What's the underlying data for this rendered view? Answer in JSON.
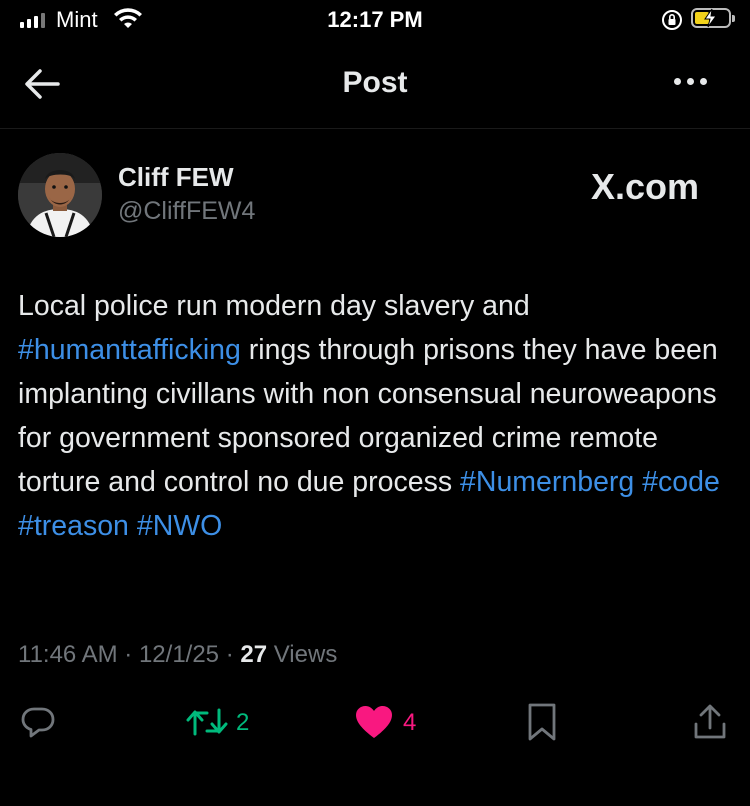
{
  "status_bar": {
    "carrier": "Mint",
    "time": "12:17 PM"
  },
  "header": {
    "title": "Post",
    "back_icon": "arrow-left-icon",
    "more_icon": "more-horizontal-icon"
  },
  "post": {
    "author": {
      "name": "Cliff FEW",
      "handle": "@CliffFEW4"
    },
    "brand": "X.com",
    "text_segments": [
      {
        "text": "Local police run modern day slavery and ",
        "hashtag": false
      },
      {
        "text": "#humanttafficking",
        "hashtag": true
      },
      {
        "text": " rings through prisons they have been implanting civillans with non consensual neuroweapons for government sponsored organized crime remote torture and control no due process ",
        "hashtag": false
      },
      {
        "text": "#Numernberg",
        "hashtag": true
      },
      {
        "text": " ",
        "hashtag": false
      },
      {
        "text": "#code",
        "hashtag": true
      },
      {
        "text": " ",
        "hashtag": false
      },
      {
        "text": "#treason",
        "hashtag": true
      },
      {
        "text": " ",
        "hashtag": false
      },
      {
        "text": "#NWO",
        "hashtag": true
      }
    ],
    "meta": {
      "time": "11:46 AM",
      "sep1": " · ",
      "date": "12/1/25",
      "sep2": " · ",
      "views_count": "27",
      "views_label": " Views"
    }
  },
  "actions": {
    "reply_count": "",
    "retweet_count": "2",
    "like_count": "4"
  },
  "colors": {
    "background": "#000000",
    "text": "#e7e9ea",
    "secondary": "#71767b",
    "hashtag": "#1d9bf0",
    "retweet": "#00ba7c",
    "like": "#f91880"
  }
}
